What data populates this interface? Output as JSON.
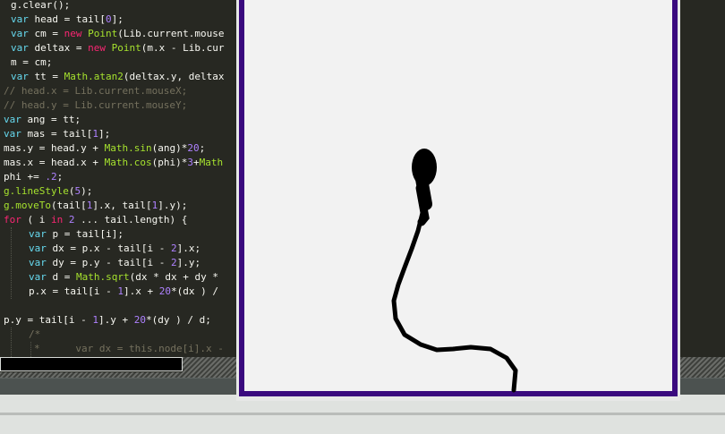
{
  "editor": {
    "lines": [
      "g.clear();",
      "var head = tail[0];",
      "var cm = new Point(Lib.current.mouse",
      "var deltax = new Point(m.x - Lib.cur",
      "m = cm;",
      "var tt = Math.atan2(deltax.y, deltax",
      "// head.x = Lib.current.mouseX;",
      "// head.y = Lib.current.mouseY;",
      "var ang = tt;",
      "var mas = tail[1];",
      "mas.y = head.y + Math.sin(ang)*20;",
      "mas.x = head.x + Math.cos(phi)*3+Math",
      "phi += .2;",
      "g.lineStyle(5);",
      "g.moveTo(tail[1].x, tail[1].y);",
      "for ( i in 2 ... tail.length) {",
      "var p = tail[i];",
      "var dx = p.x - tail[i - 2].x;",
      "var dy = p.y - tail[i - 2].y;",
      "var d = Math.sqrt(dx * dx + dy *",
      "p.x = tail[i - 1].x + 20*(dx ) /",
      "",
      "p.y = tail[i - 1].y + 20*(dy ) / d;",
      "/*",
      "*      var dx = this.node[i].x -"
    ]
  },
  "stage": {
    "frame_color": "#3a0a7e",
    "background": "#f2f2f2",
    "creature": "black tadpole-like worm following the mouse"
  },
  "colors": {
    "editor_bg": "#272822",
    "keyword": "#66d9ef",
    "control": "#f92672",
    "number": "#ae81ff",
    "function": "#a6e22e",
    "comment": "#75715e"
  }
}
